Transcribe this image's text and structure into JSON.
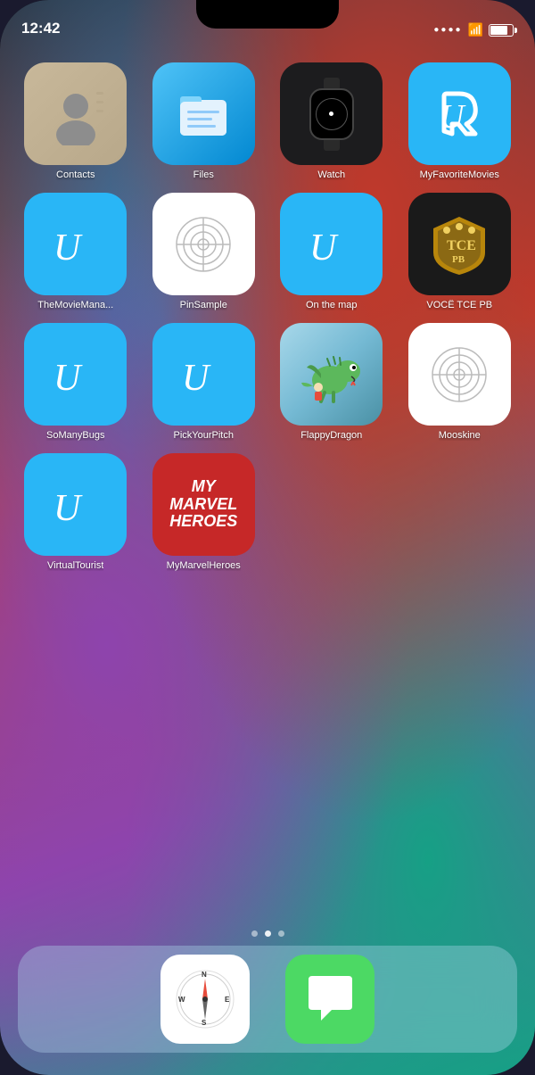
{
  "statusBar": {
    "time": "12:42"
  },
  "apps": {
    "row1": [
      {
        "id": "contacts",
        "label": "Contacts",
        "iconType": "contacts"
      },
      {
        "id": "files",
        "label": "Files",
        "iconType": "files"
      },
      {
        "id": "watch",
        "label": "Watch",
        "iconType": "watch"
      },
      {
        "id": "myfavoritemovies",
        "label": "MyFavoriteMovies",
        "iconType": "udacity-cyan"
      }
    ],
    "row2": [
      {
        "id": "themoviemanager",
        "label": "TheMovieMana...",
        "iconType": "udacity-cyan"
      },
      {
        "id": "pinsample",
        "label": "PinSample",
        "iconType": "grid"
      },
      {
        "id": "onthemap",
        "label": "On the map",
        "iconType": "udacity-cyan"
      },
      {
        "id": "vocetcepb",
        "label": "VOCÊ TCE PB",
        "iconType": "shield"
      }
    ],
    "row3": [
      {
        "id": "somanybugs",
        "label": "SoManyBugs",
        "iconType": "udacity-cyan"
      },
      {
        "id": "pickyourpitch",
        "label": "PickYourPitch",
        "iconType": "udacity-cyan"
      },
      {
        "id": "flappydragon",
        "label": "FlappyDragon",
        "iconType": "flappy"
      },
      {
        "id": "mooskine",
        "label": "Mooskine",
        "iconType": "grid"
      }
    ],
    "row4": [
      {
        "id": "virtualtourist",
        "label": "VirtualTourist",
        "iconType": "udacity-cyan"
      },
      {
        "id": "mymarvelheroes",
        "label": "MyMarvelHeroes",
        "iconType": "marvel"
      }
    ]
  },
  "pageDots": [
    {
      "active": false
    },
    {
      "active": true
    },
    {
      "active": false
    }
  ],
  "dock": {
    "apps": [
      {
        "id": "safari",
        "label": "Safari",
        "iconType": "safari"
      },
      {
        "id": "messages",
        "label": "Messages",
        "iconType": "messages"
      }
    ]
  }
}
